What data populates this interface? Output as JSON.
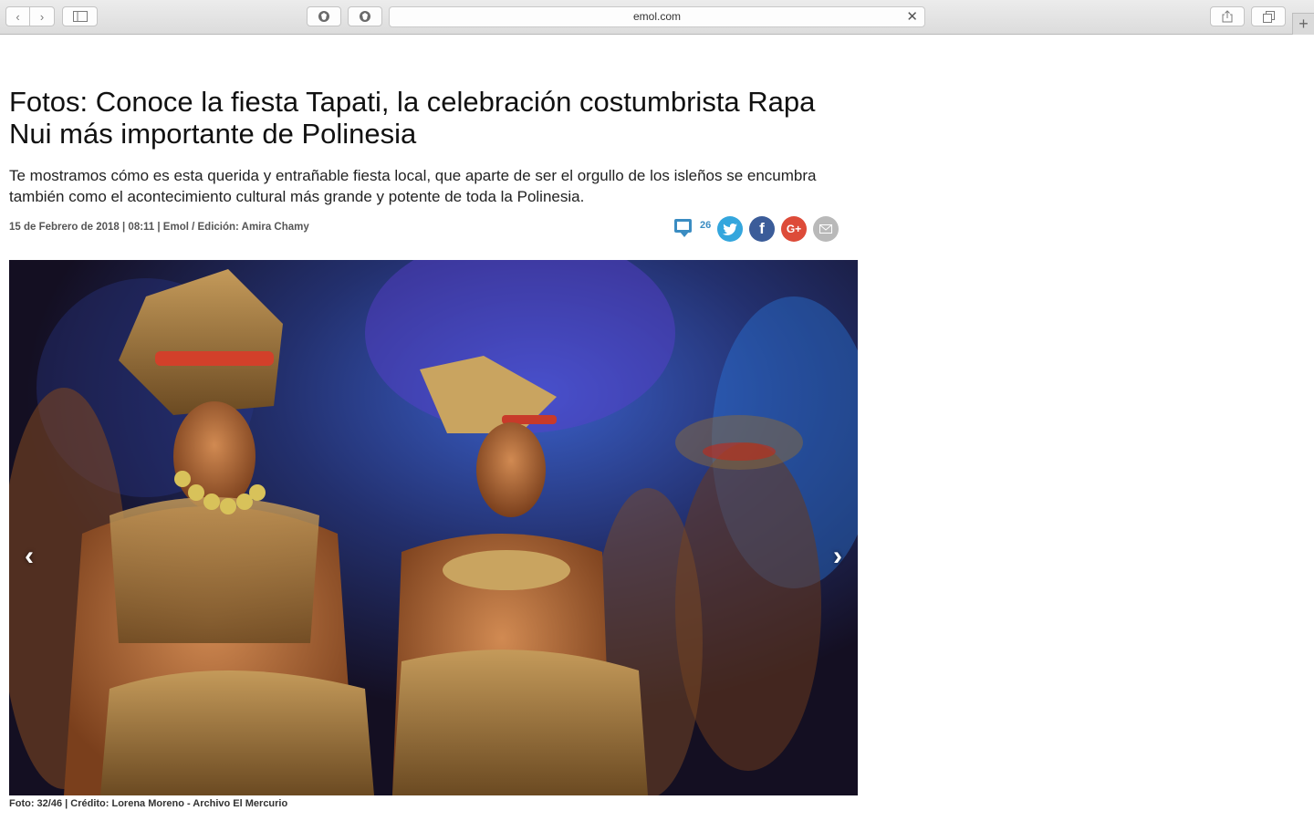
{
  "browser": {
    "url": "emol.com",
    "back_icon": "‹",
    "forward_icon": "›",
    "sidebar_icon": "▭",
    "new_tab_icon": "+"
  },
  "article": {
    "title": "Fotos: Conoce la fiesta Tapati, la celebración costumbrista Rapa Nui más importante de Polinesia",
    "lead": "Te mostramos cómo es esta querida y entrañable fiesta local, que aparte de ser el orgullo de los isleños se encumbra también como el acontecimiento cultural más grande y potente de toda la Polinesia.",
    "meta": "15 de Febrero de 2018 | 08:11 | Emol / Edición: Amira Chamy"
  },
  "social": {
    "comment_count": "26",
    "facebook_glyph": "f",
    "googleplus_glyph": "G+",
    "colors": {
      "twitter": "#34a6dd",
      "facebook": "#3b5c99",
      "googleplus": "#dd4b39",
      "mail": "#b9b9b9",
      "comments": "#3a8cc2"
    }
  },
  "gallery": {
    "caption": "Foto: 32/46 | Crédito: Lorena Moreno - Archivo El Mercurio",
    "prev_glyph": "‹",
    "next_glyph": "›"
  }
}
